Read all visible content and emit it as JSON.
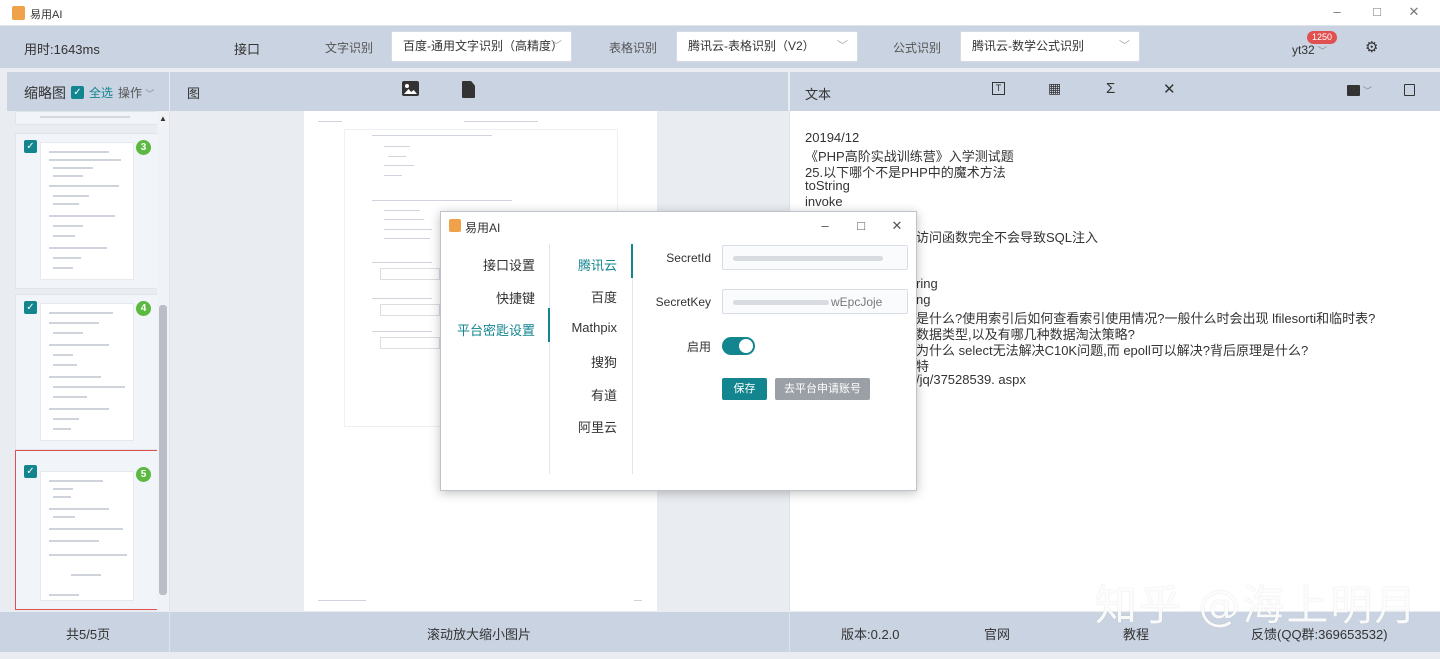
{
  "app": {
    "title": "易用AI",
    "window_controls": {
      "min": "–",
      "max": "□",
      "close": "✕"
    }
  },
  "topbar": {
    "elapsed": "用时:1643ms",
    "interface_label": "接口",
    "text_ocr_label": "文字识别",
    "text_ocr_value": "百度-通用文字识别（高精度）",
    "table_ocr_label": "表格识别",
    "table_ocr_value": "腾讯云-表格识别（V2）",
    "formula_ocr_label": "公式识别",
    "formula_ocr_value": "腾讯云-数学公式识别",
    "user": "yt32",
    "notification_count": "1250"
  },
  "left_header": {
    "title": "缩略图",
    "select_all": "全选",
    "actions": "操作"
  },
  "thumbnails": [
    {
      "badge": "3",
      "checked": true,
      "active": false
    },
    {
      "badge": "4",
      "checked": true,
      "active": false
    },
    {
      "badge": "5",
      "checked": true,
      "active": true
    }
  ],
  "mid_header": {
    "title": "图"
  },
  "right_header": {
    "title": "文本"
  },
  "result_text": [
    "20194/12",
    "《PHP高阶实战训练营》入学测试题",
    "25.以下哪个不是PHP中的魔术方法",
    "toString",
    "invoke",
    "访问函数完全不会导致SQL注入",
    "ring",
    "ng",
    "是什么?使用索引后如何查看索引使用情况?一般什么时会出现 lfilesorti和临时表?",
    "数据类型,以及有哪几种数据淘汰策略?",
    "为什么 select无法解决C10K问题,而 epoll可以解决?背后原理是什么?",
    "特",
    "/jq/37528539. aspx"
  ],
  "dialog": {
    "title": "易用AI",
    "nav_left": [
      "接口设置",
      "快捷键",
      "平台密匙设置"
    ],
    "nav_right": [
      "腾讯云",
      "百度",
      "Mathpix",
      "搜狗",
      "有道",
      "阿里云"
    ],
    "secret_id_label": "SecretId",
    "secret_key_label": "SecretKey",
    "secret_key_visible": "wEpcJoje",
    "enable_label": "启用",
    "enabled": true,
    "save_button": "保存",
    "apply_button": "去平台申请账号"
  },
  "footer": {
    "pages": "共5/5页",
    "hint": "滚动放大缩小图片",
    "version": "版本:0.2.0",
    "website": "官网",
    "tutorial": "教程",
    "feedback": "反馈(QQ群:369653532)"
  },
  "watermark": "知乎 @海上明月",
  "colors": {
    "accent": "#13858f",
    "badge_green": "#5bb840",
    "header_bg": "#c9d3e1",
    "notify_red": "#e05050"
  }
}
